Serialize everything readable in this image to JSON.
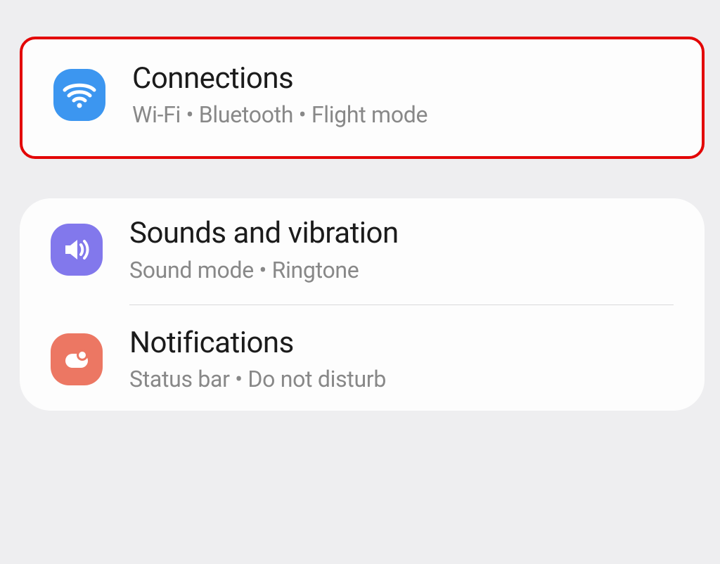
{
  "groups": [
    {
      "items": [
        {
          "id": "connections",
          "title": "Connections",
          "subtitle": "Wi-Fi  •  Bluetooth  •  Flight mode",
          "icon": "wifi-icon",
          "icon_color": "#3c96f0"
        }
      ],
      "highlighted": true
    },
    {
      "items": [
        {
          "id": "sounds",
          "title": "Sounds and vibration",
          "subtitle": "Sound mode  •  Ringtone",
          "icon": "speaker-icon",
          "icon_color": "#8278ec"
        },
        {
          "id": "notifications",
          "title": "Notifications",
          "subtitle": "Status bar  •  Do not disturb",
          "icon": "notification-icon",
          "icon_color": "#ec7763"
        }
      ],
      "highlighted": false
    }
  ]
}
